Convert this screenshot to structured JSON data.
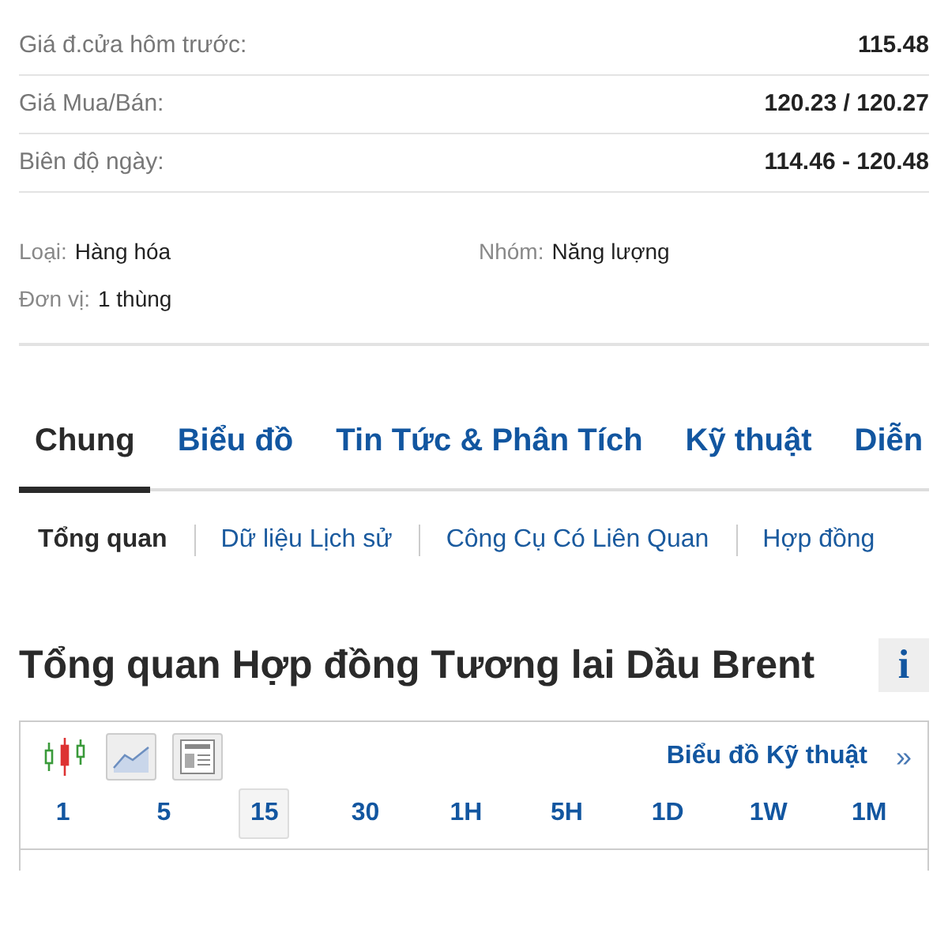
{
  "quote_rows": [
    {
      "label": "Giá đ.cửa hôm trước:",
      "value": "115.48"
    },
    {
      "label": "Giá Mua/Bán:",
      "value": "120.23 / 120.27"
    },
    {
      "label": "Biên độ ngày:",
      "value": "114.46 - 120.48"
    }
  ],
  "details": [
    {
      "label": "Loại:",
      "value": "Hàng hóa"
    },
    {
      "label": "Nhóm:",
      "value": "Năng lượng"
    },
    {
      "label": "Đơn vị:",
      "value": "1 thùng"
    }
  ],
  "tabs": [
    {
      "label": "Chung",
      "selected": true
    },
    {
      "label": "Biểu đồ",
      "selected": false
    },
    {
      "label": "Tin Tức & Phân Tích",
      "selected": false
    },
    {
      "label": "Kỹ thuật",
      "selected": false
    },
    {
      "label": "Diễn",
      "selected": false
    }
  ],
  "subnav": [
    {
      "label": "Tổng quan",
      "selected": true
    },
    {
      "label": "Dữ liệu Lịch sử",
      "selected": false
    },
    {
      "label": "Công Cụ Có Liên Quan",
      "selected": false
    },
    {
      "label": "Hợp đồng",
      "selected": false
    }
  ],
  "section": {
    "title": "Tổng quan Hợp đồng Tương lai Dầu Brent",
    "info_button": "i"
  },
  "chart_panel": {
    "chart_types": [
      {
        "kind": "candlestick"
      },
      {
        "kind": "line"
      },
      {
        "kind": "table"
      }
    ],
    "link": "Biểu đồ Kỹ thuật",
    "link_arrow": "»",
    "timeframes": [
      {
        "label": "1",
        "selected": false
      },
      {
        "label": "5",
        "selected": false
      },
      {
        "label": "15",
        "selected": true
      },
      {
        "label": "30",
        "selected": false
      },
      {
        "label": "1H",
        "selected": false
      },
      {
        "label": "5H",
        "selected": false
      },
      {
        "label": "1D",
        "selected": false
      },
      {
        "label": "1W",
        "selected": false
      },
      {
        "label": "1M",
        "selected": false
      }
    ]
  }
}
